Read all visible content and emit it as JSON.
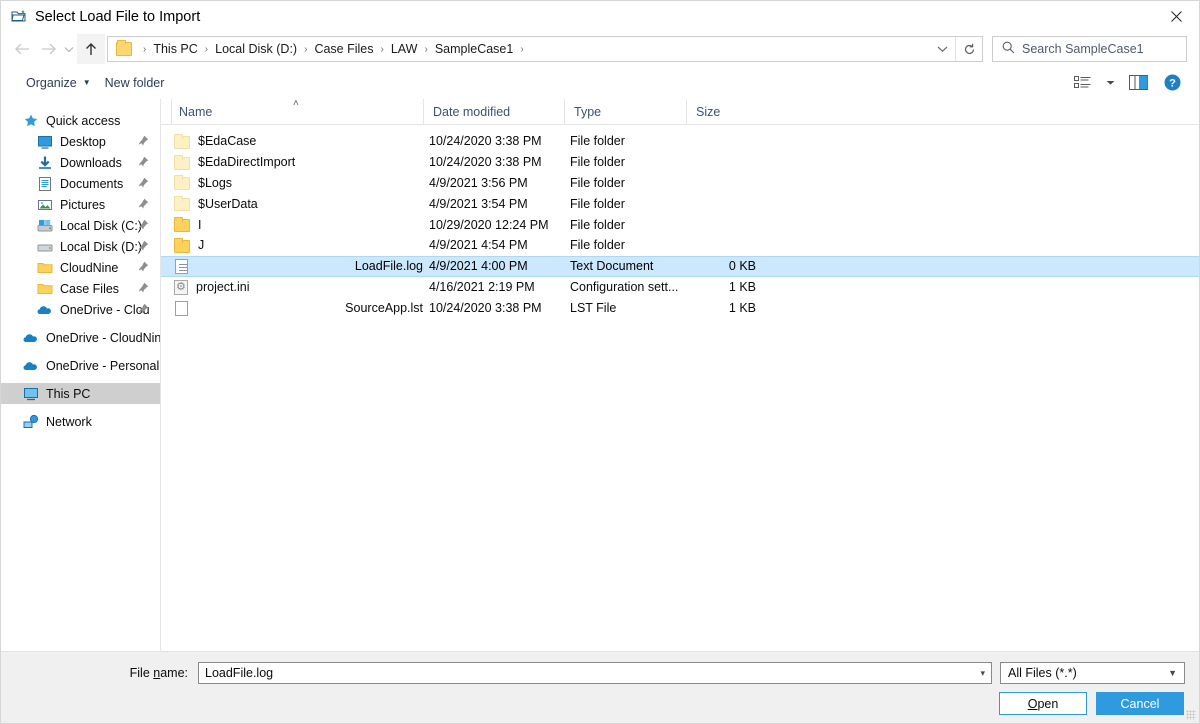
{
  "window": {
    "title": "Select Load File to Import",
    "icon": "open-folder-import-icon",
    "close_label": "✕"
  },
  "addressbar": {
    "back_icon": "arrow-left-icon",
    "forward_icon": "arrow-right-icon",
    "history_icon": "chevron-down-icon",
    "up_icon": "arrow-up-icon",
    "folder_icon": "folder-icon",
    "breadcrumbs": [
      "This PC",
      "Local Disk (D:)",
      "Case Files",
      "LAW",
      "SampleCase1"
    ],
    "separator": "›",
    "dropdown_icon": "chevron-down-icon",
    "refresh_icon": "refresh-icon"
  },
  "search": {
    "icon": "search-icon",
    "placeholder": "Search SampleCase1"
  },
  "toolbar": {
    "organize_label": "Organize",
    "organize_caret": "▼",
    "new_folder_label": "New folder",
    "view_icon": "view-list-icon",
    "view_caret": "▼",
    "preview_pane_icon": "preview-pane-icon",
    "help_icon": "help-icon",
    "help_glyph": "?"
  },
  "sidebar": {
    "items": [
      {
        "label": "Quick access",
        "icon": "quick-access-star-icon",
        "indent": false,
        "pinned": false,
        "selected": false
      },
      {
        "label": "Desktop",
        "icon": "desktop-icon",
        "indent": true,
        "pinned": true,
        "selected": false
      },
      {
        "label": "Downloads",
        "icon": "downloads-icon",
        "indent": true,
        "pinned": true,
        "selected": false
      },
      {
        "label": "Documents",
        "icon": "documents-icon",
        "indent": true,
        "pinned": true,
        "selected": false
      },
      {
        "label": "Pictures",
        "icon": "pictures-icon",
        "indent": true,
        "pinned": true,
        "selected": false
      },
      {
        "label": "Local Disk (C:)",
        "icon": "windows-drive-icon",
        "indent": true,
        "pinned": true,
        "selected": false
      },
      {
        "label": "Local Disk (D:)",
        "icon": "drive-icon",
        "indent": true,
        "pinned": true,
        "selected": false
      },
      {
        "label": "CloudNine",
        "icon": "folder-icon",
        "indent": true,
        "pinned": true,
        "selected": false
      },
      {
        "label": "Case Files",
        "icon": "folder-icon",
        "indent": true,
        "pinned": true,
        "selected": false
      },
      {
        "label": "OneDrive - Clou",
        "icon": "onedrive-icon",
        "indent": true,
        "pinned": true,
        "selected": false
      },
      {
        "label": "OneDrive - CloudNin",
        "icon": "onedrive-icon",
        "indent": false,
        "pinned": false,
        "selected": false,
        "gap_before": true
      },
      {
        "label": "OneDrive - Personal",
        "icon": "onedrive-icon",
        "indent": false,
        "pinned": false,
        "selected": false,
        "gap_before": true
      },
      {
        "label": "This PC",
        "icon": "this-pc-icon",
        "indent": false,
        "pinned": false,
        "selected": true,
        "gap_before": true
      },
      {
        "label": "Network",
        "icon": "network-icon",
        "indent": false,
        "pinned": false,
        "selected": false,
        "gap_before": true
      }
    ]
  },
  "filelist": {
    "sort_indicator": "˄",
    "columns": [
      "Name",
      "Date modified",
      "Type",
      "Size"
    ],
    "rows": [
      {
        "name": "$EdaCase",
        "date": "10/24/2020 3:38 PM",
        "type": "File folder",
        "size": "",
        "icon": "folder-dim-icon",
        "selected": false
      },
      {
        "name": "$EdaDirectImport",
        "date": "10/24/2020 3:38 PM",
        "type": "File folder",
        "size": "",
        "icon": "folder-dim-icon",
        "selected": false
      },
      {
        "name": "$Logs",
        "date": "4/9/2021 3:56 PM",
        "type": "File folder",
        "size": "",
        "icon": "folder-dim-icon",
        "selected": false
      },
      {
        "name": "$UserData",
        "date": "4/9/2021 3:54 PM",
        "type": "File folder",
        "size": "",
        "icon": "folder-dim-icon",
        "selected": false
      },
      {
        "name": "I",
        "date": "10/29/2020 12:24 PM",
        "type": "File folder",
        "size": "",
        "icon": "folder-icon",
        "selected": false
      },
      {
        "name": "J",
        "date": "4/9/2021 4:54 PM",
        "type": "File folder",
        "size": "",
        "icon": "folder-icon",
        "selected": false
      },
      {
        "name": "LoadFile.log",
        "date": "4/9/2021 4:00 PM",
        "type": "Text Document",
        "size": "0 KB",
        "icon": "text-document-icon",
        "selected": true
      },
      {
        "name": "project.ini",
        "date": "4/16/2021 2:19 PM",
        "type": "Configuration sett...",
        "size": "1 KB",
        "icon": "config-settings-icon",
        "selected": false
      },
      {
        "name": "SourceApp.lst",
        "date": "10/24/2020 3:38 PM",
        "type": "LST File",
        "size": "1 KB",
        "icon": "blank-file-icon",
        "selected": false
      }
    ]
  },
  "footer": {
    "filename_label_pre": "File ",
    "filename_label_acc": "n",
    "filename_label_post": "ame:",
    "filename_value": "LoadFile.log",
    "filename_caret": "▾",
    "filter_value": "All Files (*.*)",
    "filter_caret": "▼",
    "open_pre": "",
    "open_acc": "O",
    "open_post": "pen",
    "cancel_label": "Cancel"
  },
  "colors": {
    "accent": "#2e9bdf",
    "selection": "#cce8ff",
    "folder": "#fdd25c",
    "header_text": "#3c5173"
  }
}
